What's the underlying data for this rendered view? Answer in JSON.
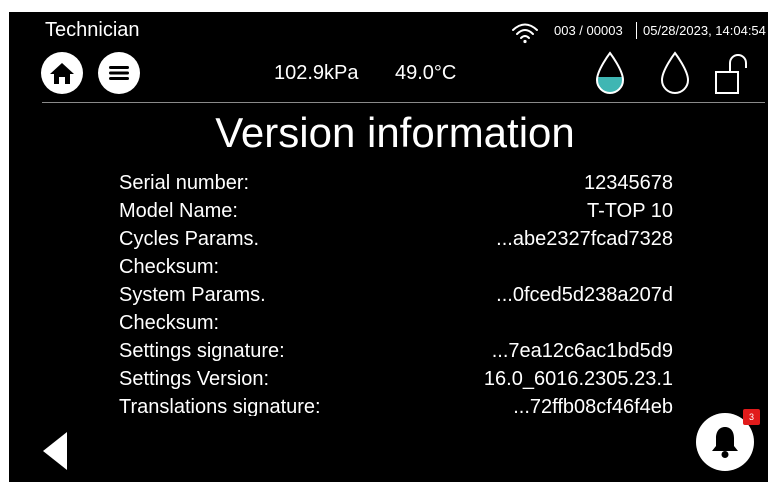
{
  "header": {
    "user_role": "Technician",
    "counter": "003 / 00003",
    "datetime": "05/28/2023, 14:04:54",
    "icons": [
      "wifi-icon",
      "home-icon",
      "menu-icon",
      "water-drop-filled-icon",
      "water-drop-outline-icon",
      "unlock-icon"
    ]
  },
  "status": {
    "pressure": "102.9kPa",
    "temperature": "49.0°C"
  },
  "page": {
    "title": "Version information"
  },
  "info": [
    {
      "label": "Serial number:",
      "value": "12345678"
    },
    {
      "label": "Model Name:",
      "value": "T-TOP 10"
    },
    {
      "label": "Cycles Params. Checksum:",
      "value": "...abe2327fcad7328"
    },
    {
      "label": "System Params. Checksum:",
      "value": "...0fced5d238a207d"
    },
    {
      "label": "Settings signature:",
      "value": "...7ea12c6ac1bd5d9"
    },
    {
      "label": "Settings Version:",
      "value": "16.0_6016.2305.23.1"
    },
    {
      "label": "Translations signature:",
      "value": "...72ffb08cf46f4eb"
    }
  ],
  "footer": {
    "notification_count": "3"
  },
  "colors": {
    "background": "#000000",
    "foreground": "#ffffff",
    "water_fill": "#3fb6b3",
    "badge": "#e11b1b"
  }
}
